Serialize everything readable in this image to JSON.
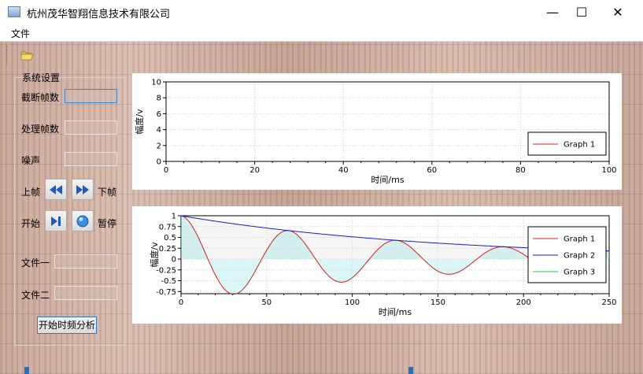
{
  "window": {
    "title": "杭州茂华智翔信息技术有限公司",
    "minimize": "—",
    "maximize": "☐",
    "close": "✕"
  },
  "menu": {
    "file": "文件"
  },
  "toolbar": {
    "open_icon": "folder-open-icon"
  },
  "settings": {
    "group_title": "系统设置",
    "truncate_frames": "截断帧数",
    "process_frames": "处理帧数",
    "noise": "噪声",
    "prev_frame": "上帧",
    "next_frame": "下帧",
    "start": "开始",
    "pause": "暂停",
    "file1": "文件一",
    "file2": "文件二",
    "analyze": "开始时频分析"
  },
  "chart_data": [
    {
      "type": "line",
      "xlabel": "时间/ms",
      "ylabel": "幅度/v",
      "xlim": [
        0,
        100
      ],
      "ylim": [
        0,
        10
      ],
      "xticks": [
        "0",
        "20",
        "40",
        "60",
        "80",
        "100"
      ],
      "yticks": [
        "0",
        "2",
        "4",
        "6",
        "8",
        "10"
      ],
      "series": [
        {
          "name": "Graph 1",
          "color": "#d02020",
          "values": []
        }
      ],
      "legend": "bottom-right",
      "grid": true
    },
    {
      "type": "line",
      "xlabel": "时间/ms",
      "ylabel": "幅度/v",
      "xlim": [
        0,
        250
      ],
      "ylim": [
        -0.8,
        1
      ],
      "xticks": [
        "0",
        "50",
        "100",
        "150",
        "200",
        "250"
      ],
      "yticks": [
        "-0.75",
        "-0.5",
        "-0.25",
        "0",
        "0.25",
        "0.5",
        "0.75",
        "1"
      ],
      "series": [
        {
          "name": "Graph 1",
          "color": "#d02020",
          "description": "damped cosine exp(-x/150)*cos(x/10)"
        },
        {
          "name": "Graph 2",
          "color": "#1a1ad0",
          "description": "envelope exp(-x/150)"
        },
        {
          "name": "Graph 3",
          "color": "#22cc22",
          "description": ""
        }
      ],
      "legend": "right",
      "grid": true
    }
  ]
}
